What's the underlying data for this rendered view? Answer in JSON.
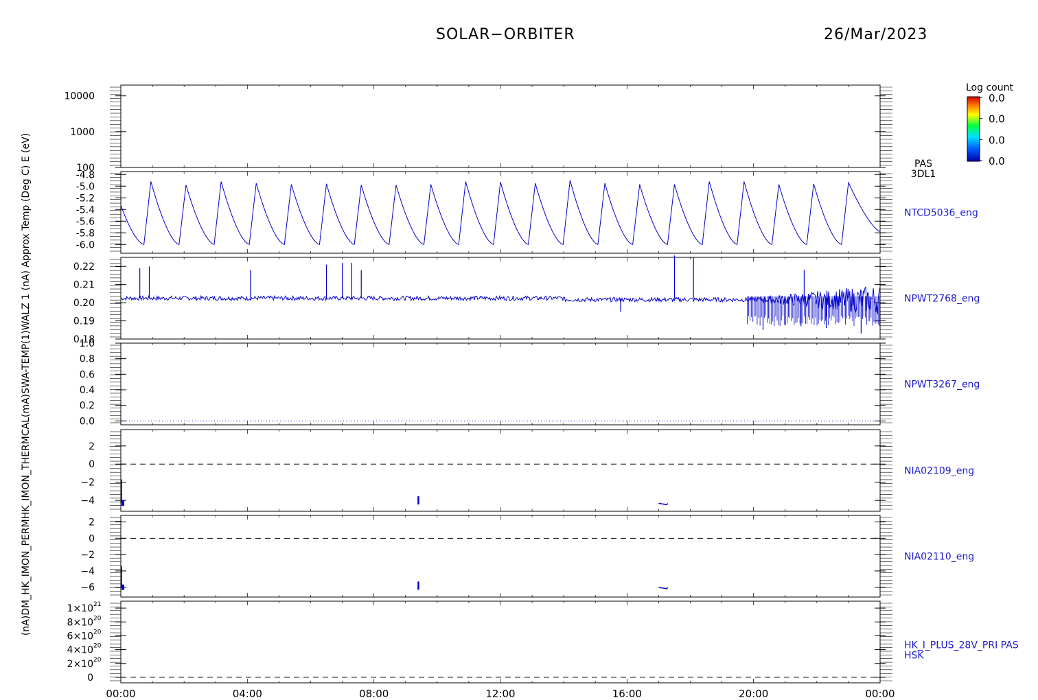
{
  "header": {
    "title": "SOLAR−ORBITER",
    "date": "26/Mar/2023"
  },
  "colors": {
    "trace": "#0000cc",
    "frame": "#000000",
    "label": "#1a1acc"
  },
  "colorbar": {
    "title": "Log count",
    "ticks": [
      "0.0",
      "0.0",
      "0.0",
      "0.0"
    ]
  },
  "x_axis": {
    "ticks": [
      "00:00",
      "04:00",
      "08:00",
      "12:00",
      "16:00",
      "20:00",
      "00:00"
    ],
    "range_hours": [
      0,
      24
    ]
  },
  "chart_data": [
    {
      "type": "heatmap",
      "name": "PAS 3DL1",
      "right_label": [
        "PAS",
        "3DL1"
      ],
      "ylabel": "E (eV)",
      "log_y": true,
      "ylim": [
        100,
        20000
      ],
      "ytick_values": [
        100,
        1000,
        10000
      ],
      "ytick_labels": [
        "100",
        "1000",
        "10000"
      ],
      "values": []
    },
    {
      "type": "line",
      "name": "NTCD5036_eng",
      "right_label": [
        "NTCD5036_eng"
      ],
      "ylabel": "Approx Temp (Deg C)",
      "ylim": [
        -6.15,
        -4.75
      ],
      "ytick_values": [
        -4.8,
        -5.0,
        -5.2,
        -5.4,
        -5.6,
        -5.8,
        -6.0
      ],
      "ytick_labels": [
        "-4.8",
        "-5.0",
        "-5.2",
        "-5.4",
        "-5.6",
        "-5.8",
        "-6.0"
      ],
      "sawtooth": {
        "peaks_hours": [
          0.95,
          2.06,
          3.17,
          4.28,
          5.39,
          6.5,
          7.6,
          8.7,
          9.8,
          10.9,
          12.0,
          13.1,
          14.2,
          15.3,
          16.4,
          17.5,
          18.6,
          19.7,
          20.8,
          21.9,
          23.0
        ],
        "peak_values": [
          -4.92,
          -4.98,
          -4.92,
          -4.95,
          -4.97,
          -4.96,
          -4.98,
          -4.98,
          -4.97,
          -4.92,
          -4.93,
          -4.95,
          -4.9,
          -4.95,
          -4.97,
          -4.97,
          -4.92,
          -4.92,
          -4.97,
          -4.96,
          -4.94
        ],
        "trough_value": -6.0,
        "start_value": -5.33,
        "end_value": -5.78
      }
    },
    {
      "type": "line",
      "name": "NPWT2768_eng",
      "right_label": [
        "NPWT2768_eng"
      ],
      "ylabel": "SWA-TEMP(1)",
      "ylim": [
        0.18,
        0.225
      ],
      "ytick_values": [
        0.18,
        0.19,
        0.2,
        0.21,
        0.22
      ],
      "ytick_labels": [
        "0.18",
        "0.19",
        "0.20",
        "0.21",
        "0.22"
      ],
      "baseline": 0.2025,
      "spikes": [
        [
          0.6,
          0.219
        ],
        [
          0.9,
          0.22
        ],
        [
          4.1,
          0.218
        ],
        [
          6.5,
          0.221
        ],
        [
          7.0,
          0.222
        ],
        [
          7.3,
          0.222
        ],
        [
          7.6,
          0.218
        ],
        [
          17.5,
          0.226
        ],
        [
          18.1,
          0.225
        ],
        [
          21.6,
          0.218
        ]
      ],
      "dips": [
        [
          15.8,
          0.195
        ],
        [
          20.3,
          0.185
        ],
        [
          21.5,
          0.187
        ],
        [
          22.3,
          0.186
        ],
        [
          23.4,
          0.183
        ]
      ]
    },
    {
      "type": "line",
      "name": "NPWT3267_eng",
      "right_label": [
        "NPWT3267_eng"
      ],
      "ylabel": "WALZ 1",
      "ylim": [
        -0.05,
        1.0
      ],
      "ytick_values": [
        0.0,
        0.2,
        0.4,
        0.6,
        0.8,
        1.0
      ],
      "ytick_labels": [
        "0.0",
        "0.2",
        "0.4",
        "0.6",
        "0.8",
        "1.0"
      ],
      "baseline": 0.0
    },
    {
      "type": "line",
      "name": "NIA02109_eng",
      "right_label": [
        "NIA02109_eng"
      ],
      "ylabel": "HK MCA (mA)",
      "ylim": [
        -5.2,
        3.8
      ],
      "ytick_values": [
        2,
        0,
        -2,
        -4
      ],
      "ytick_labels": [
        "2",
        "0",
        "−2",
        "−4"
      ],
      "zero_line": 0,
      "events": [
        [
          0.0,
          -4.3
        ],
        [
          9.4,
          -4.0
        ],
        [
          17.0,
          -4.4
        ]
      ]
    },
    {
      "type": "line",
      "name": "NIA02110_eng",
      "right_label": [
        "NIA02110_eng"
      ],
      "ylabel": "HK PERM (mA)",
      "ylim": [
        -7.2,
        2.8
      ],
      "ytick_values": [
        2,
        0,
        -2,
        -4,
        -6
      ],
      "ytick_labels": [
        "2",
        "0",
        "−2",
        "−4",
        "−6"
      ],
      "zero_line": 0,
      "events": [
        [
          0.0,
          -6.0
        ],
        [
          9.4,
          -5.8
        ],
        [
          17.0,
          -6.1
        ]
      ]
    },
    {
      "type": "line",
      "name": "HK_I_PLUS_28V_PRI PAS HSK",
      "right_label": [
        "HK_I_PLUS_28V_PRI PAS",
        "HSK"
      ],
      "ylabel": "(mA)",
      "ylim": [
        -8e+19,
        1.1e+21
      ],
      "ytick_values": [
        0,
        2e+20,
        4e+20,
        6e+20,
        8e+20,
        1e+21
      ],
      "ytick_labels": [
        [
          "0",
          ""
        ],
        [
          "2×10",
          "20"
        ],
        [
          "4×10",
          "20"
        ],
        [
          "6×10",
          "20"
        ],
        [
          "8×10",
          "20"
        ],
        [
          "1×10",
          "21"
        ]
      ],
      "zero_line": 0
    }
  ],
  "left_axis_text": "(nA)DM_HK_IMON_PERMHK_IMON_THERMCAL(mA)SWA-TEMP(1)WALZ 1 (nA) Approx Temp (Deg C) E (eV)"
}
